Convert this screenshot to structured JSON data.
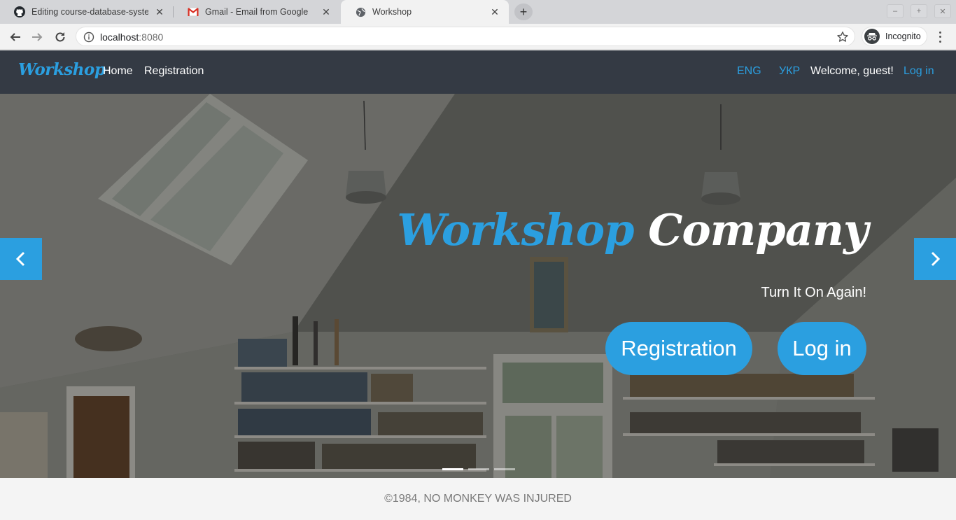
{
  "browser": {
    "tabs": [
      {
        "title": "Editing course-database-system",
        "favicon": "github-icon"
      },
      {
        "title": "Gmail - Email from Google",
        "favicon": "gmail-icon"
      },
      {
        "title": "Workshop",
        "favicon": "globe-icon",
        "active": true
      }
    ],
    "address": {
      "host": "localhost",
      "port": ":8080"
    },
    "profile_label": "Incognito"
  },
  "navbar": {
    "brand": "Workshop",
    "links": [
      "Home",
      "Registration"
    ],
    "lang_en": "ENG",
    "lang_uk": "УКР",
    "welcome": "Welcome, guest!",
    "login": "Log in"
  },
  "hero": {
    "title_part1": "Workshop",
    "title_part2": "Company",
    "tagline": "Turn It On Again!",
    "registration_button": "Registration",
    "login_button": "Log in",
    "slide_count": 3,
    "active_slide": 1
  },
  "footer": {
    "text": "©1984, NO MONKEY WAS INJURED"
  },
  "colors": {
    "accent": "#2b9fe0",
    "navbar_bg": "#343a44",
    "footer_bg": "#f4f4f4"
  }
}
